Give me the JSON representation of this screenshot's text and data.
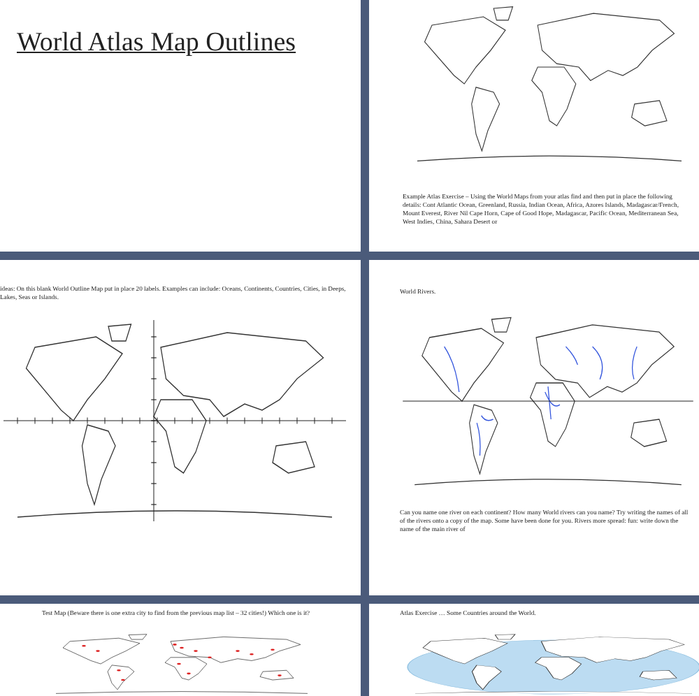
{
  "pages": [
    {
      "kind": "title",
      "title": "World Atlas Map Outlines"
    },
    {
      "kind": "plain",
      "caption_below": "Example Atlas Exercise – Using the World Maps from your atlas find and then put in place the following details: Cont Atlantic Ocean, Greenland, Russia, Indian Ocean, Africa, Azores Islands, Madagascar/French, Mount Everest, River Nil Cape Horn, Cape of Good Hope, Madagascar, Pacific Ocean, Mediterranean Sea, West Indies, China, Sahara Desert or"
    },
    {
      "kind": "grid",
      "caption_above": "ideas: On this blank World Outline Map put in place 20 labels. Examples can include: Oceans, Continents, Countries, Cities, in Deeps, Lakes, Seas or Islands."
    },
    {
      "kind": "rivers",
      "caption_above": "World Rivers.",
      "caption_below": "Can you name one river on each continent? How many World rivers can you name? Try writing the names of all of the rivers onto a copy of the map. Some have been done for you. Rivers more spread: fun: write down the name of the main river of"
    },
    {
      "kind": "pins",
      "caption_above": "Test Map (Beware there is one extra city to find from the previous map list – 32 cities!) Which one is it?"
    },
    {
      "kind": "shaded",
      "caption_above": "Atlas Exercise … Some Countries around the World."
    }
  ]
}
